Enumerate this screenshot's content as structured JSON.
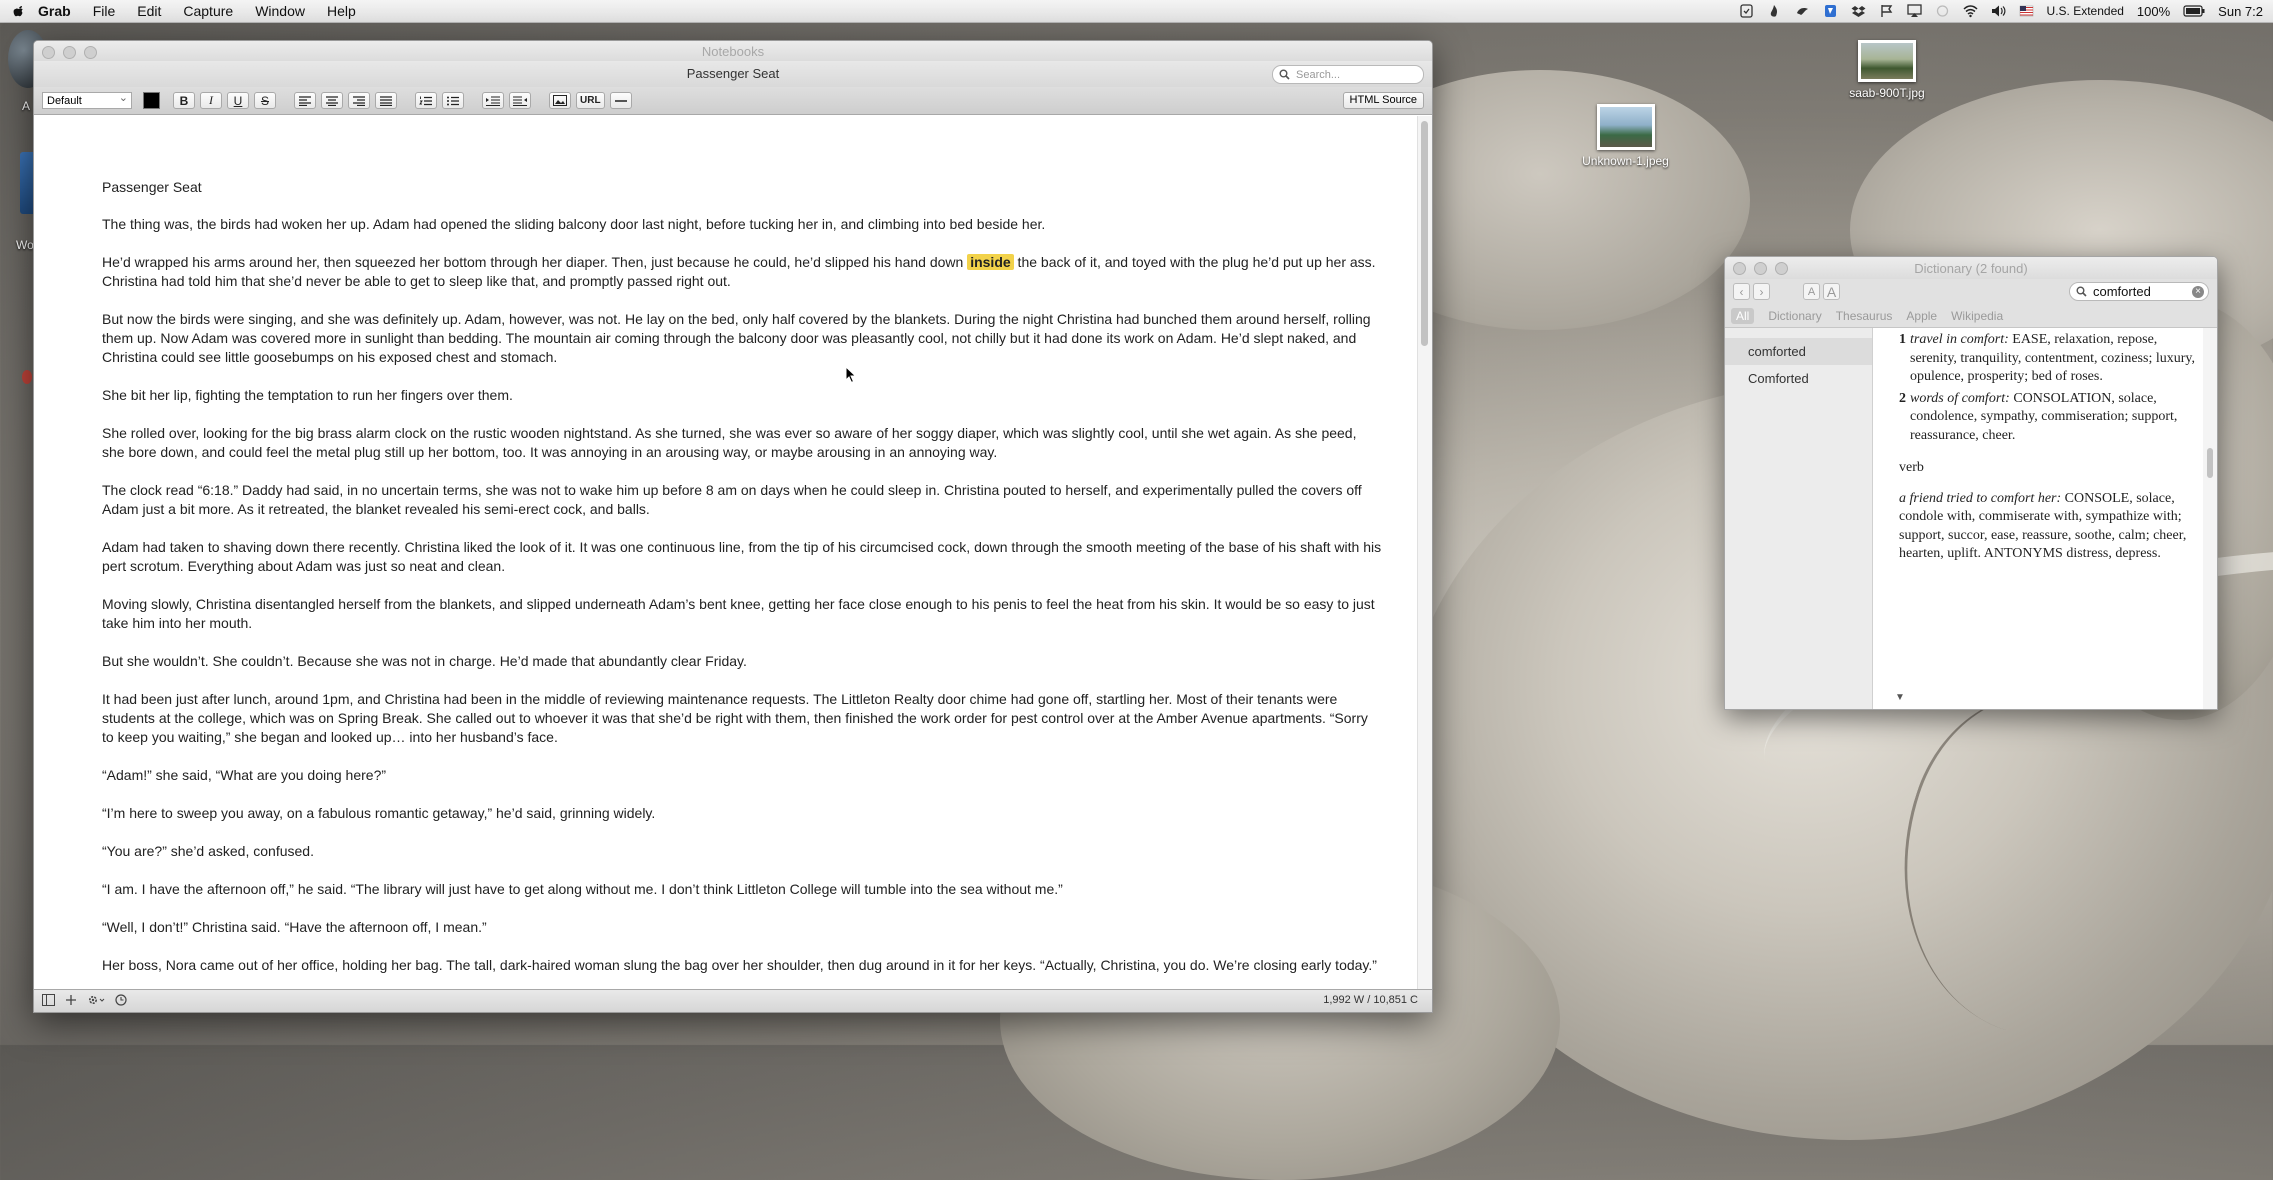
{
  "menubar": {
    "app": "Grab",
    "items": [
      "File",
      "Edit",
      "Capture",
      "Window",
      "Help"
    ],
    "status": {
      "input_source": "U.S. Extended",
      "battery": "100%",
      "clock": "Sun 7:2"
    }
  },
  "desktop": {
    "icons": [
      {
        "label": "saab-900T.jpg",
        "icon": "photo-thumbnail-icon"
      },
      {
        "label": "Unknown-1.jpeg",
        "icon": "photo-thumbnail-icon"
      }
    ],
    "partial_labels": [
      "A",
      "Wo"
    ]
  },
  "notebooks": {
    "app_title": "Notebooks",
    "doc_title": "Passenger Seat",
    "search_placeholder": "Search...",
    "style_select": "Default",
    "toolbar": {
      "bold": "B",
      "italic": "I",
      "underline": "U",
      "strike": "S",
      "url": "URL",
      "html_source": "HTML Source"
    },
    "document": {
      "title": "Passenger Seat",
      "paragraphs": [
        "The thing was, the birds had woken her up.  Adam had opened the sliding balcony door last night, before tucking her in, and climbing into bed beside her.",
        "He’d wrapped his arms around her, then squeezed her bottom through her diaper.  Then, just because he could, he’d slipped his hand down {HL} the back of it, and toyed with the plug he’d put up her ass.  Christina had told him that she’d never be able to get to sleep like that, and promptly passed right out.",
        "But now the birds were singing, and she was definitely up.  Adam, however, was not.  He lay on the bed, only half covered by the blankets.  During the night Christina had bunched them around herself, rolling them up.  Now Adam was covered more in sunlight than bedding.  The mountain air coming through the balcony door was pleasantly cool, not chilly but it had done its work on Adam.  He’d slept naked, and Christina could see little goosebumps on his exposed chest and stomach.",
        "She bit her lip, fighting the temptation to run her fingers over them.",
        "She rolled over, looking for the big brass alarm clock on the rustic wooden nightstand.  As she turned, she was ever so aware of her soggy diaper, which was slightly cool, until she wet again.  As she peed, she bore down, and could feel the metal plug still up her bottom, too.  It was annoying in an arousing way, or maybe arousing in an annoying way.",
        "The clock read “6:18.”  Daddy had said, in no uncertain terms, she was not to wake him up before 8 am on days when he could sleep in.  Christina pouted to herself, and experimentally pulled the covers off Adam just a bit more.  As it retreated,  the blanket revealed his semi-erect cock, and balls.",
        "Adam had taken to shaving down there recently.  Christina liked the look of it.  It was one continuous line, from the tip of his circumcised cock, down through the smooth meeting of the base of his shaft with his pert scrotum.  Everything about Adam was just so neat and clean.",
        "Moving slowly, Christina disentangled herself from the blankets, and slipped underneath Adam’s bent knee, getting her face close enough to his penis to feel the heat from his skin.  It would be so easy to just take him into her mouth.",
        "But she wouldn’t.  She couldn’t.  Because she was not in charge.  He’d made that abundantly clear Friday.",
        "It had been just after lunch, around 1pm, and Christina had been in the middle of reviewing maintenance requests.  The Littleton Realty door chime had gone off, startling her.  Most of their tenants were students at the college, which was on Spring Break.  She called out to whoever it was that she’d be right with them, then finished the work order for pest control over at the Amber Avenue apartments.  “Sorry to keep you waiting,” she began and looked up…  into her husband’s face.",
        "“Adam!” she said, “What are you doing here?”",
        "“I’m here to sweep you away, on a fabulous romantic getaway,” he’d said, grinning widely.",
        "“You are?” she’d asked, confused.",
        "“I am.  I have the afternoon off,” he said.  “The library will just have to get along without me.  I don’t think Littleton College will tumble into the sea without me.”",
        "“Well, I don’t!” Christina said.  “Have the afternoon off, I mean.”",
        "Her boss, Nora came out of her office, holding her bag.  The tall, dark-haired woman slung the bag over her shoulder, then dug around in it for her keys.  “Actually, Christina, you do.  We’re closing early today.”"
      ],
      "highlight_word": "inside"
    },
    "status_count": "1,992 W / 10,851 C"
  },
  "dictionary": {
    "title": "Dictionary (2 found)",
    "search_value": "comforted",
    "sources": [
      "All",
      "Dictionary",
      "Thesaurus",
      "Apple",
      "Wikipedia"
    ],
    "results": [
      "comforted",
      "Comforted"
    ],
    "entry": {
      "senses": [
        {
          "num": "1",
          "label": "travel in comfort:",
          "text": " EASE, relaxation, repose, serenity, tranquility, contentment, coziness; luxury, opulence, prosperity; bed of roses."
        },
        {
          "num": "2",
          "label": "words of comfort:",
          "text": " CONSOLATION, solace, condolence, sympathy, commiseration; support, reassurance, cheer."
        }
      ],
      "pos": "verb",
      "verb_example": "a friend tried to comfort her:",
      "verb_text": " CONSOLE, solace, condole with, commiserate with, sympathize with; support, succor, ease, reassure, soothe, calm; cheer, hearten, uplift. ANTONYMS distress, depress."
    }
  }
}
